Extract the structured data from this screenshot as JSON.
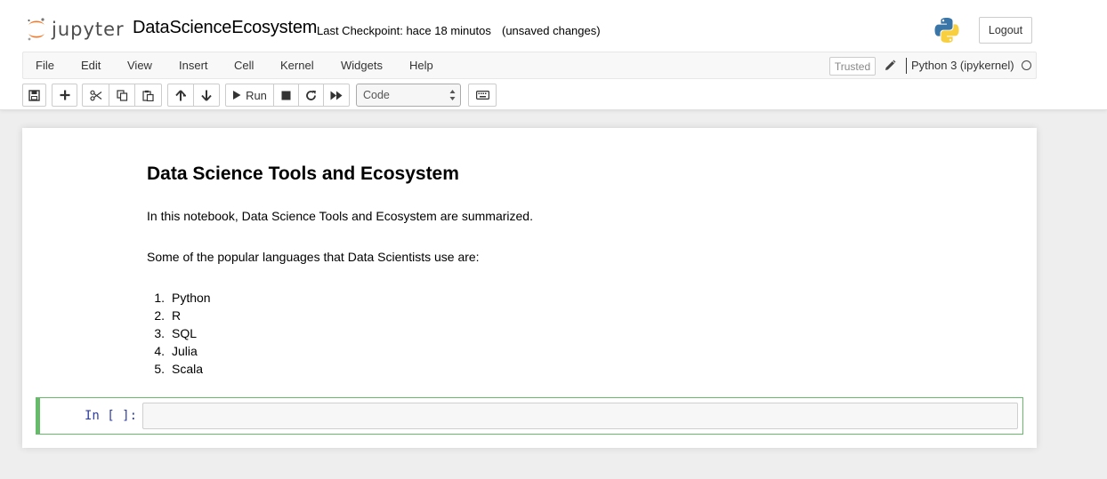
{
  "header": {
    "logo_text": "jupyter",
    "notebook_title": "DataScienceEcosystem",
    "checkpoint": "Last Checkpoint: hace 18 minutos",
    "autosave_status": "(unsaved changes)",
    "logout_label": "Logout"
  },
  "menubar": {
    "items": [
      "File",
      "Edit",
      "View",
      "Insert",
      "Cell",
      "Kernel",
      "Widgets",
      "Help"
    ],
    "trusted_label": "Trusted",
    "kernel_name": "Python 3 (ipykernel)"
  },
  "toolbar": {
    "run_label": "Run",
    "cell_type": "Code",
    "buttons": [
      "save-icon",
      "plus-icon",
      "scissors-icon",
      "copy-icon",
      "paste-icon",
      "arrow-up-icon",
      "arrow-down-icon",
      "play-icon",
      "stop-icon",
      "restart-icon",
      "fast-forward-icon",
      "keyboard-icon"
    ]
  },
  "markdown_cell": {
    "heading": "Data Science Tools and Ecosystem",
    "intro": "In this notebook, Data Science Tools and Ecosystem are summarized.",
    "languages_intro": "Some of the popular languages that Data Scientists use are:",
    "languages": [
      {
        "num": "1.",
        "name": "Python"
      },
      {
        "num": "2.",
        "name": "R"
      },
      {
        "num": "3.",
        "name": "SQL"
      },
      {
        "num": "4.",
        "name": "Julia"
      },
      {
        "num": "5.",
        "name": "Scala"
      }
    ]
  },
  "code_cell": {
    "prompt": "In [ ]:",
    "content": ""
  },
  "colors": {
    "edit_mode_border": "#66bb6a",
    "prompt_color": "#303f9f",
    "logo_orange": "#f37726"
  }
}
